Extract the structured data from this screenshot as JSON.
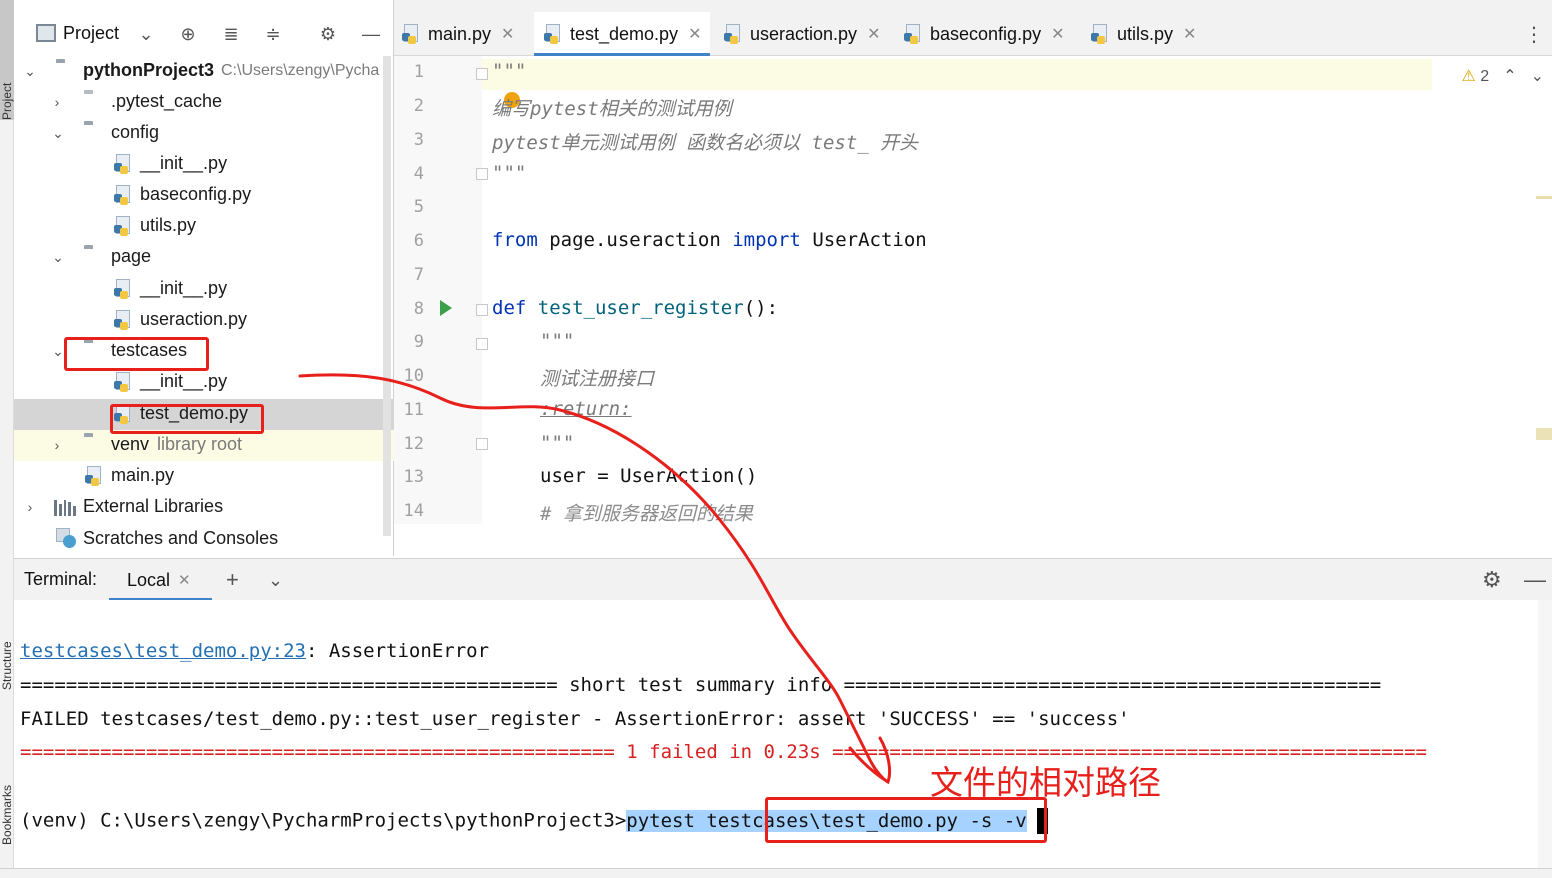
{
  "side_strip": {
    "top_tab": "Project",
    "mid_tab": "Structure",
    "bottom_tab": "Bookmarks"
  },
  "project_panel": {
    "title": "Project",
    "tree": [
      {
        "label": "pythonProject3",
        "suffix": "C:\\Users\\zengy\\Pycha"
      },
      {
        "label": ".pytest_cache"
      },
      {
        "label": "config"
      },
      {
        "label": "__init__.py"
      },
      {
        "label": "baseconfig.py"
      },
      {
        "label": "utils.py"
      },
      {
        "label": "page"
      },
      {
        "label": "__init__.py"
      },
      {
        "label": "useraction.py"
      },
      {
        "label": "testcases"
      },
      {
        "label": "__init__.py"
      },
      {
        "label": "test_demo.py"
      },
      {
        "label": "venv",
        "suffix": "library root"
      },
      {
        "label": "main.py"
      },
      {
        "label": "External Libraries"
      },
      {
        "label": "Scratches and Consoles"
      }
    ]
  },
  "editor_tabs": [
    {
      "label": "main.py"
    },
    {
      "label": "test_demo.py"
    },
    {
      "label": "useraction.py"
    },
    {
      "label": "baseconfig.py"
    },
    {
      "label": "utils.py"
    }
  ],
  "editor": {
    "warning_count": "2",
    "line_numbers": [
      "1",
      "2",
      "3",
      "4",
      "5",
      "6",
      "7",
      "8",
      "9",
      "10",
      "11",
      "12",
      "13",
      "14"
    ],
    "lines": {
      "l1": "\"\"\"",
      "l2": "编写pytest相关的测试用例",
      "l3": "pytest单元测试用例 函数名必须以 test_ 开头",
      "l4": "\"\"\"",
      "l6_from": "from",
      "l6_mod": " page.useraction ",
      "l6_import": "import",
      "l6_name": " UserAction",
      "l8_def": "def",
      "l8_fn": "test_user_register",
      "l8_rest": "():",
      "l9": "\"\"\"",
      "l10": "测试注册接口",
      "l11": ":return:",
      "l12": "\"\"\"",
      "l13": "user = UserAction()",
      "l14": "# 拿到服务器返回的结果"
    }
  },
  "terminal": {
    "label": "Terminal:",
    "tab": "Local",
    "lines": {
      "err_link": "testcases\\test_demo.py:23",
      "err_rest": ": AssertionError",
      "summary": "=============================================== short test summary info ===============================================",
      "failed": "FAILED testcases/test_demo.py::test_user_register - AssertionError: assert 'SUCCESS' == 'success'",
      "result": "==================================================== 1 failed in 0.23s ====================================================",
      "prompt": "(venv) C:\\Users\\zengy\\PycharmProjects\\pythonProject3>",
      "cmd1": "pytest ",
      "cmd2": "testcases\\test_demo.py",
      "cmd3": " -s -v"
    }
  },
  "annotation": {
    "text": "文件的相对路径",
    "color": "#e8201c"
  },
  "colors": {
    "accent": "#4083c9",
    "keyword": "#0033b3",
    "function": "#00627a",
    "error": "#d82020",
    "link": "#2470b3"
  }
}
